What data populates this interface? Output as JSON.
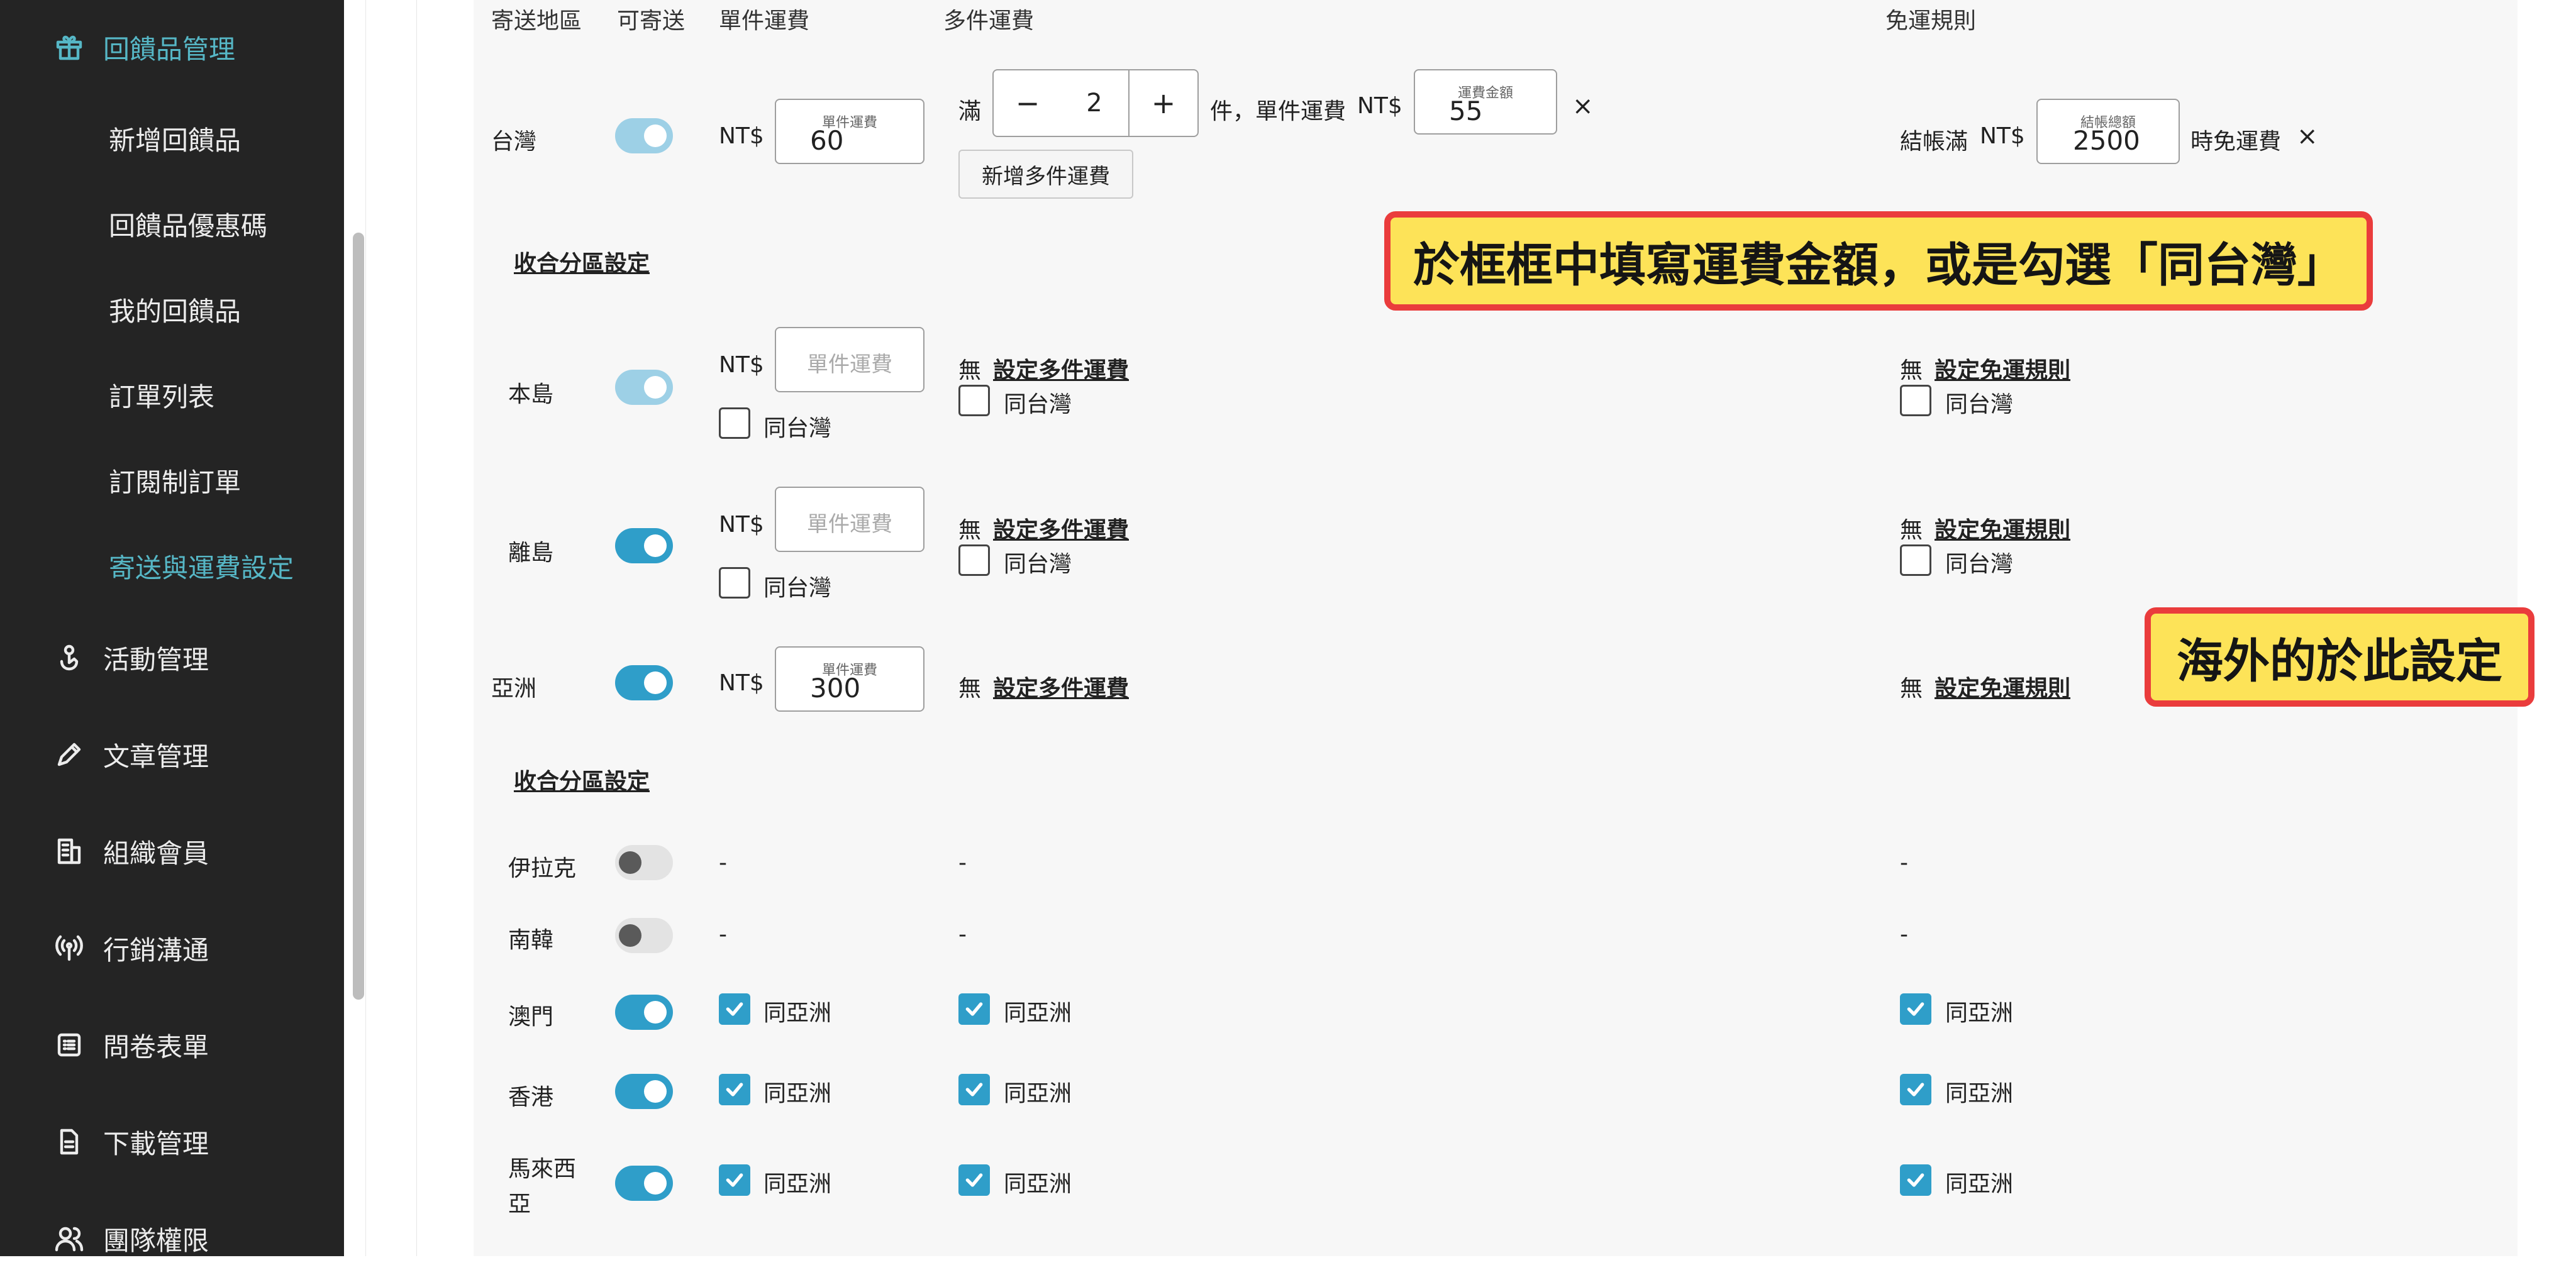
{
  "sidebar": {
    "items": [
      {
        "label": "回饋品管理",
        "icon": "gift-icon"
      },
      {
        "label": "新增回饋品"
      },
      {
        "label": "回饋品優惠碼"
      },
      {
        "label": "我的回饋品"
      },
      {
        "label": "訂單列表"
      },
      {
        "label": "訂閱制訂單"
      },
      {
        "label": "寄送與運費設定"
      },
      {
        "label": "活動管理",
        "icon": "hand-pointer-icon"
      },
      {
        "label": "文章管理",
        "icon": "pen-icon"
      },
      {
        "label": "組織會員",
        "icon": "building-icon"
      },
      {
        "label": "行銷溝通",
        "icon": "broadcast-icon"
      },
      {
        "label": "問卷表單",
        "icon": "list-icon"
      },
      {
        "label": "下載管理",
        "icon": "document-icon"
      },
      {
        "label": "團隊權限",
        "icon": "users-icon"
      }
    ]
  },
  "table": {
    "headers": {
      "region": "寄送地區",
      "shippable": "可寄送",
      "single_fee": "單件運費",
      "multi_fee": "多件運費",
      "free_rule": "免運規則"
    }
  },
  "taiwan": {
    "name": "台灣",
    "currency": "NT$",
    "single_fee_label": "單件運費",
    "single_fee_value": "60",
    "multi_prefix": "滿",
    "multi_qty": "2",
    "multi_suffix": "件，單件運費",
    "multi_fee_label": "運費金額",
    "multi_fee_value": "55",
    "close_symbol": "×",
    "add_multi_button": "新增多件運費",
    "free_prefix": "結帳滿",
    "free_amount_label": "結帳總額",
    "free_amount_value": "2500",
    "free_suffix": "時免運費",
    "minus": "−",
    "plus": "+"
  },
  "collapse_label": "收合分區設定",
  "subregions_tw": [
    {
      "name": "本島",
      "toggle": "on-dim"
    },
    {
      "name": "離島",
      "toggle": "on"
    }
  ],
  "common": {
    "placeholder_single": "單件運費",
    "same_tw": "同台灣",
    "none": "無",
    "set_multi": "設定多件運費",
    "set_free": "設定免運規則",
    "same_asia": "同亞洲",
    "dash": "-"
  },
  "asia": {
    "name": "亞洲",
    "single_fee_label": "單件運費",
    "single_fee_value": "300"
  },
  "subregions_asia": [
    {
      "name": "伊拉克",
      "toggle": "off"
    },
    {
      "name": "南韓",
      "toggle": "off"
    },
    {
      "name": "澳門",
      "toggle": "on"
    },
    {
      "name": "香港",
      "toggle": "on"
    },
    {
      "name": "馬來西亞",
      "toggle": "on"
    }
  ],
  "callouts": {
    "fill_hint": "於框框中填寫運費金額，或是勾選「同台灣」",
    "overseas_hint": "海外的於此設定"
  },
  "colors": {
    "accent": "#56b7c6",
    "toggle_on": "#2f9ec9",
    "callout_bg": "#fde358",
    "callout_border": "#ea3c3c"
  }
}
